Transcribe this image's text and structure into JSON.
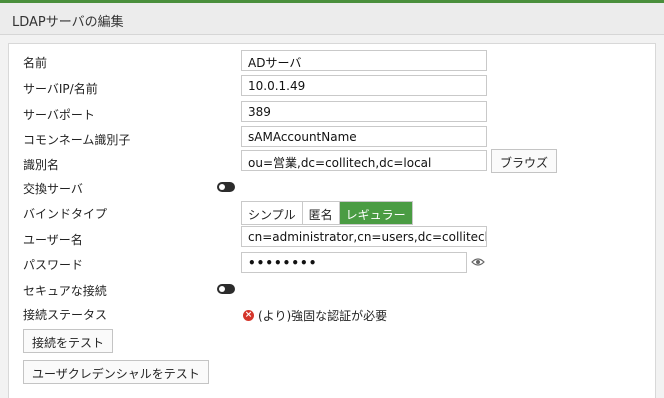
{
  "header": {
    "title": "LDAPサーバの編集"
  },
  "form": {
    "name_label": "名前",
    "name_value": "ADサーバ",
    "ip_label": "サーバIP/名前",
    "ip_value": "10.0.1.49",
    "port_label": "サーバポート",
    "port_value": "389",
    "cn_label": "コモンネーム識別子",
    "cn_value": "sAMAccountName",
    "dn_label": "識別名",
    "dn_value": "ou=営業,dc=collitech,dc=local",
    "browse_label": "ブラウズ",
    "exchange_label": "交換サーバ",
    "exchange_enabled": false,
    "bind_label": "バインドタイプ",
    "bind_options": [
      "シンプル",
      "匿名",
      "レギュラー"
    ],
    "bind_selected": "レギュラー",
    "user_label": "ユーザー名",
    "user_value": "cn=administrator,cn=users,dc=collitech",
    "password_label": "パスワード",
    "password_value": "••••••••",
    "secure_label": "セキュアな接続",
    "secure_enabled": false,
    "status_label": "接続ステータス",
    "status_value": "(より)強固な認証が必要",
    "test_connection_label": "接続をテスト",
    "test_credentials_label": "ユーザクレデンシャルをテスト"
  },
  "icons": {
    "toggle": "toggle-icon",
    "eye": "eye-icon",
    "error": "error-icon"
  },
  "colors": {
    "accent": "#4a9c43",
    "error": "#d5362b"
  }
}
